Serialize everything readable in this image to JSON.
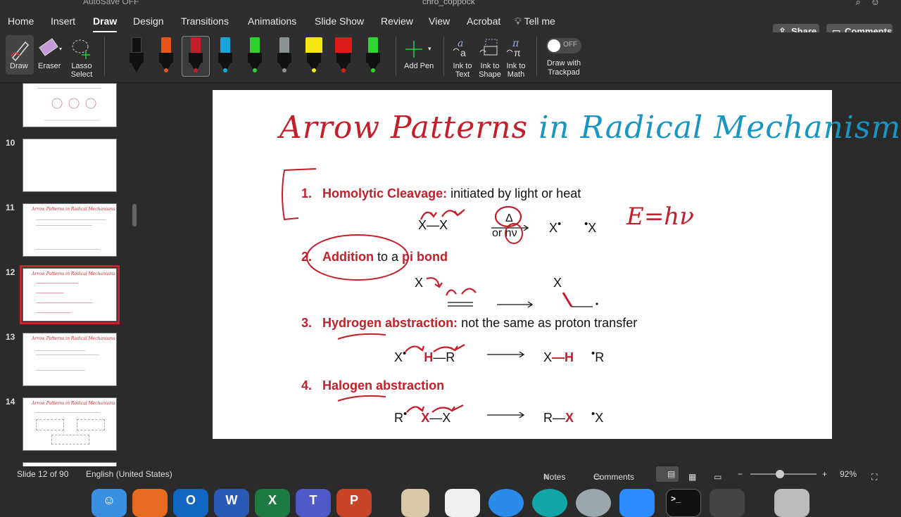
{
  "titlebar": {
    "autosave": "AutoSave",
    "autosave_state": "OFF",
    "doc_title": "chro_coppock"
  },
  "tabs": [
    "Home",
    "Insert",
    "Draw",
    "Design",
    "Transitions",
    "Animations",
    "Slide Show",
    "Review",
    "View",
    "Acrobat",
    "Tell me"
  ],
  "active_tab": "Draw",
  "header_buttons": {
    "share": "Share",
    "comments": "Comments"
  },
  "toolbar": {
    "draw": "Draw",
    "eraser": "Eraser",
    "lasso": "Lasso Select",
    "add_pen": "Add Pen",
    "ink_to_text": "Ink to Text",
    "ink_to_shape": "Ink to Shape",
    "ink_to_math": "Ink to Math",
    "draw_trackpad": "Draw with Trackpad",
    "trackpad_toggle": "OFF",
    "pen_colors": [
      "#111111",
      "#e8561e",
      "#c41e2a",
      "#18a6d8",
      "#2fd12f",
      "#8a9296",
      "#f5e614",
      "#e01b1b",
      "#2ed62e"
    ]
  },
  "slides_panel": {
    "thumbnails": [
      {
        "num": "10",
        "title": ""
      },
      {
        "num": "11",
        "title": "Arrow Patterns in Radical Mechanisms"
      },
      {
        "num": "12",
        "title": "Arrow Patterns in Radical Mechanisms"
      },
      {
        "num": "13",
        "title": "Arrow Patterns in Radical Mechanisms"
      },
      {
        "num": "14",
        "title": "Arrow Patterns in Radical Mechanisms"
      }
    ]
  },
  "slide": {
    "title_red": "Arrow Patterns",
    "title_blue": "in Radical Mechanisms",
    "items": [
      {
        "num": "1.",
        "key": "Homolytic Cleavage:",
        "rest": " initiated by light or heat"
      },
      {
        "num": "2.",
        "key": "Addition",
        "rest": " to a ",
        "key2": "pi bond"
      },
      {
        "num": "3.",
        "key": "Hydrogen abstraction:",
        "rest": " not the same as proton transfer"
      },
      {
        "num": "4.",
        "key": "Halogen abstraction",
        "rest": ""
      }
    ],
    "rxn1": {
      "left": "X—X",
      "above": "Δ",
      "below": "or hν",
      "product1": "X",
      "product2": "X"
    },
    "annotation": "E=hν",
    "rxn2": {
      "reactant": "X",
      "product": "X"
    },
    "rxn3": {
      "x": "X",
      "h": "H",
      "r": "R",
      "p_x": "X",
      "p_h": "H",
      "p_r": "R"
    },
    "rxn4": {
      "r": "R",
      "x1": "X",
      "x2": "X",
      "p_r": "R",
      "p_x": "X",
      "p_x2": "X"
    }
  },
  "statusbar": {
    "slide_info": "Slide 12 of 90",
    "language": "English (United States)",
    "notes": "Notes",
    "comments": "Comments",
    "zoom": "92%"
  }
}
